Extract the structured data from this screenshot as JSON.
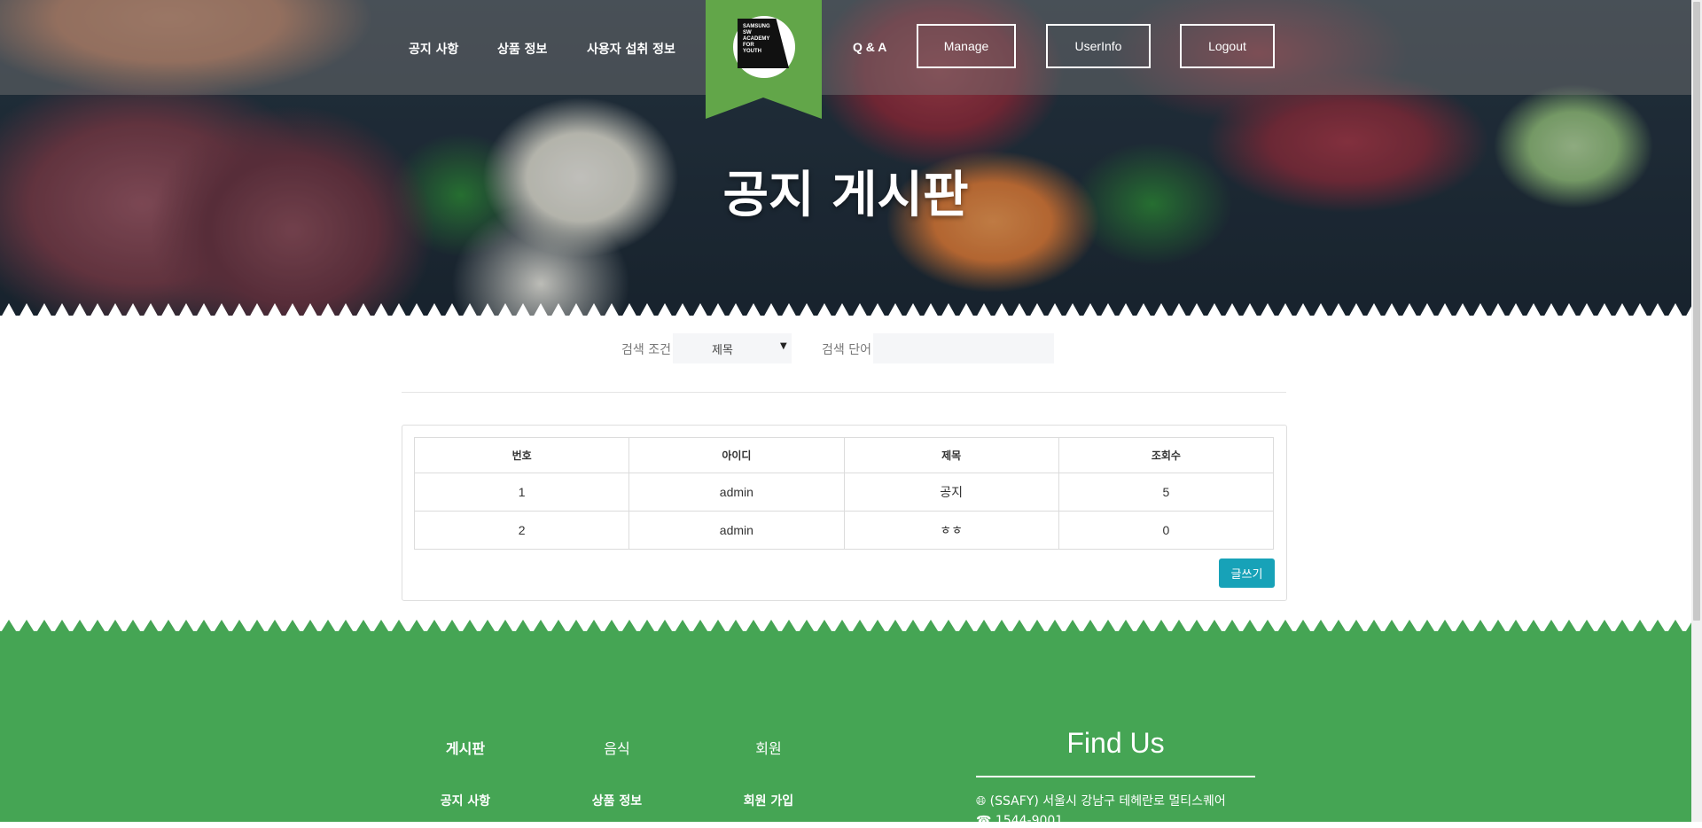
{
  "nav": {
    "links": [
      "공지 사항",
      "상품 정보",
      "사용자 섭취 정보",
      "Q & A"
    ],
    "buttons": [
      "Manage",
      "UserInfo",
      "Logout"
    ],
    "logo_text": "SAMSUNG\nSW\nACADEMY\nFOR\nYOUTH"
  },
  "hero": {
    "title": "공지 게시판"
  },
  "search": {
    "condition_label": "검색 조건",
    "condition_value": "제목",
    "word_label": "검색 단어",
    "word_value": ""
  },
  "table": {
    "headers": [
      "번호",
      "아이디",
      "제목",
      "조회수"
    ],
    "rows": [
      [
        "1",
        "admin",
        "공지",
        "5"
      ],
      [
        "2",
        "admin",
        "ㅎㅎ",
        "0"
      ]
    ],
    "write_button": "글쓰기"
  },
  "footer": {
    "columns": [
      {
        "heading": "게시판",
        "link": "공지 사항"
      },
      {
        "heading": "음식",
        "link": "상품 정보"
      },
      {
        "heading": "회원",
        "link": "회원 가입"
      }
    ],
    "find_title": "Find Us",
    "address": "(SSAFY) 서울시 강남구 테헤란로 멀티스퀘어",
    "phone": "1544-9001"
  },
  "colors": {
    "footer_green": "#45a554",
    "logo_green": "#62a649",
    "button_teal": "#17a2b8"
  },
  "icons": [
    "globe-icon",
    "phone-icon",
    "dropdown-caret-icon"
  ]
}
